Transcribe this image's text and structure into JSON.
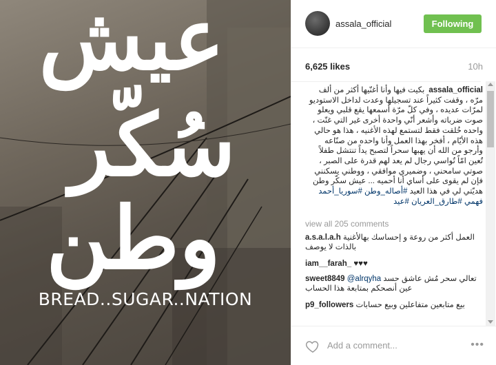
{
  "photo": {
    "calligraphy": [
      "عيش",
      "سُكّر",
      "وطن"
    ],
    "caption": "BREAD..SUGAR..NATION"
  },
  "header": {
    "avatar_text": "",
    "username": "assala_official",
    "follow_label": "Following",
    "follow_color": "#70c050"
  },
  "meta": {
    "likes": "6,625 likes",
    "time": "10h"
  },
  "caption": {
    "username": "assala_official",
    "text": "بكيت فيها وأنا أغنّيها أكثر من ألف مرّه ، وقفت كثيراً عند تسجيلها وعدت لداخل الاستوديو لمرّات عديده ، وفي كلّ مرّة أسمعها يقع قلبي ويعلو صوت ضرباته وأشعر أنّي واحدة أخرى غير التي غنّت ، واحده خُلقت فقط لتستمع لهذه الأغنيه ، هذا هو حالي هذه الأيّام ، أفخر بهذا العمل وأنا واحده من صنّاعه وأرجو من الله أن يهبها سحراً لتصبح يداً تنتشل طفلاً تُعين امّاً تُواسي رجال لم يعد لهم قدرة على الصبر ، صوتي سامحني ، وضميري موافقي ، ووطني يسكنني فإن لم يقوى على أساي أنا أحميه ... عيش سكّر وطن هديّتي لي في هذا العيد",
    "hashtags": "#أصاله_وطن #سوريا_أحمد فهمي #طارق_العريان #عيد"
  },
  "comments": {
    "view_all": "view all 205 comments",
    "items": [
      {
        "user": "a.s.a.l.a.h",
        "text": "العمل أكثر من روعة و إحساسك بهالأغنية بالذات لا يوصف"
      },
      {
        "user": "iam__farah_",
        "text": "♥♥♥"
      },
      {
        "user": "sweet8849",
        "mention": "@alrqyha",
        "text": "تعالي سحر مُش عاشق حسد عين أنصحكم بمتابعة هذا الحساب"
      },
      {
        "user": "p9_followers",
        "text": "بيع متابعين متفاعلين وبيع حسابات"
      }
    ]
  },
  "add_comment": {
    "placeholder": "Add a comment...",
    "more_label": "•••"
  }
}
